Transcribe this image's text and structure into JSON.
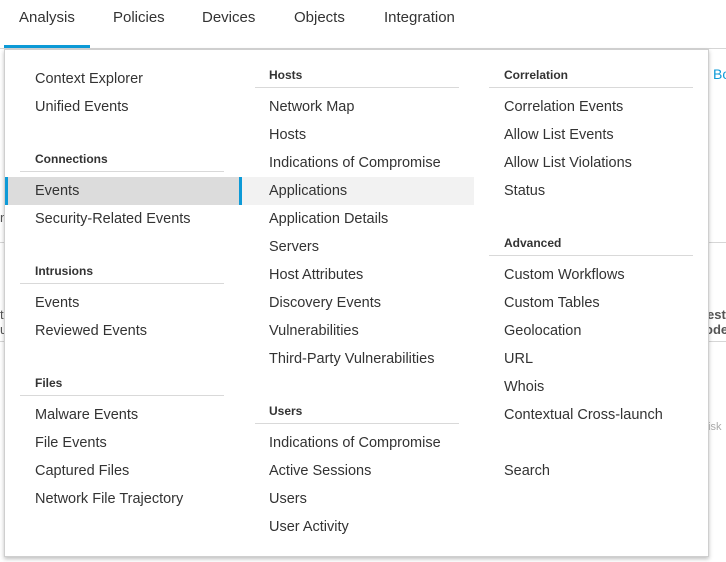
{
  "nav": {
    "tabs": [
      "Analysis",
      "Policies",
      "Devices",
      "Objects",
      "Integration"
    ]
  },
  "background": {
    "right_link": "Bo",
    "right_text1": "esti",
    "right_text2": "ode",
    "right_text3": "isk",
    "left_text1": "t",
    "left_text2": "u",
    "left_text3": "n"
  },
  "menu": {
    "col1": {
      "top_items": [
        "Context Explorer",
        "Unified Events"
      ],
      "connections": {
        "heading": "Connections",
        "items": [
          "Events",
          "Security-Related Events"
        ]
      },
      "intrusions": {
        "heading": "Intrusions",
        "items": [
          "Events",
          "Reviewed Events"
        ]
      },
      "files": {
        "heading": "Files",
        "items": [
          "Malware Events",
          "File Events",
          "Captured Files",
          "Network File Trajectory"
        ]
      }
    },
    "col2": {
      "hosts": {
        "heading": "Hosts",
        "items": [
          "Network Map",
          "Hosts",
          "Indications of Compromise",
          "Applications",
          "Application Details",
          "Servers",
          "Host Attributes",
          "Discovery Events",
          "Vulnerabilities",
          "Third-Party Vulnerabilities"
        ]
      },
      "users": {
        "heading": "Users",
        "items": [
          "Indications of Compromise",
          "Active Sessions",
          "Users",
          "User Activity"
        ]
      }
    },
    "col3": {
      "correlation": {
        "heading": "Correlation",
        "items": [
          "Correlation Events",
          "Allow List Events",
          "Allow List Violations",
          "Status"
        ]
      },
      "advanced": {
        "heading": "Advanced",
        "items": [
          "Custom Workflows",
          "Custom Tables",
          "Geolocation",
          "URL",
          "Whois",
          "Contextual Cross-launch"
        ]
      },
      "search": "Search"
    }
  },
  "colors": {
    "accent": "#0d9ad7",
    "selected_bg": "#dcdcdc",
    "hover_bg": "#f2f2f2"
  }
}
